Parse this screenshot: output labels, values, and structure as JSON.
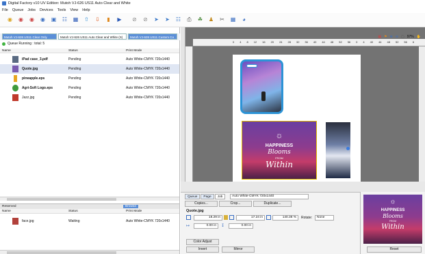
{
  "window": {
    "title": "Digital Factory v10 UV Edition: Mutoh VJ-626 US11 Auto Clear and White"
  },
  "menu": [
    "File",
    "Queue",
    "Jobs",
    "Devices",
    "Tools",
    "View",
    "Help"
  ],
  "queue_tabs": [
    "Mutoh VJ-626 US11 Clear Only",
    "Mutoh VJ-626 US11 Auto Clear and White (S)",
    "Mutoh VJ-626 US11 Custom Co"
  ],
  "queue_status": "Queue Running : total: 5",
  "columns": {
    "name": "Name",
    "status": "Status",
    "mode": "Print Mode"
  },
  "jobs": [
    {
      "name": "iPad case_3.pdf",
      "status": "Pending",
      "mode": "Auto White-CMYK 720x1440",
      "thumb": "#5a6b82"
    },
    {
      "name": "Quote.jpg",
      "status": "Pending",
      "mode": "Auto White-CMYK 720x1440",
      "thumb": "#7a5cb0"
    },
    {
      "name": "pineapple.eps",
      "status": "Pending",
      "mode": "Auto White-CMYK 720x1440",
      "thumb": "#e8a620"
    },
    {
      "name": "Agri-Soft Logo.eps",
      "status": "Pending",
      "mode": "Auto White-CMYK 720x1440",
      "thumb": "#3f9a3c"
    },
    {
      "name": "Jazz.jpg",
      "status": "Pending",
      "mode": "Auto White-CMYK 720x1440",
      "thumb": "#c0392b"
    }
  ],
  "lower": {
    "reserved": "Reserved",
    "browse": "Browse"
  },
  "reserved_jobs": [
    {
      "name": "face.jpg",
      "status": "Waiting",
      "mode": "Auto White-CMYK 720x1440"
    }
  ],
  "ruler": {
    "zoom": "97%",
    "ticks": [
      "0",
      "4",
      "8",
      "12",
      "16",
      "20",
      "24",
      "28",
      "32",
      "36",
      "40",
      "44",
      "48",
      "52",
      "56",
      "0",
      "4",
      "40",
      "44",
      "48",
      "52",
      "56",
      "6"
    ]
  },
  "artwork": {
    "headline": "HAPPINESS",
    "line2": "Blooms",
    "line3": "FROM",
    "line4": "Within"
  },
  "props": {
    "tabs": [
      "Queue",
      "Page",
      "Job"
    ],
    "print_mode": "Auto White-CMYK 720x1440",
    "buttons": [
      "Copies...",
      "Crop...",
      "Duplicate..."
    ],
    "filename": "Quote.jpg",
    "width": "18.29 in",
    "height": "17.24 in",
    "scale": "140.38 %",
    "rotate_label": "Rotate:",
    "rotate_value": "None",
    "offset_x": "0.00 in",
    "offset_y": "0.00 in",
    "color_adjust": "Color Adjust",
    "invert": "Invert",
    "mirror": "Mirror"
  },
  "preview": {
    "reset": "Reset"
  }
}
